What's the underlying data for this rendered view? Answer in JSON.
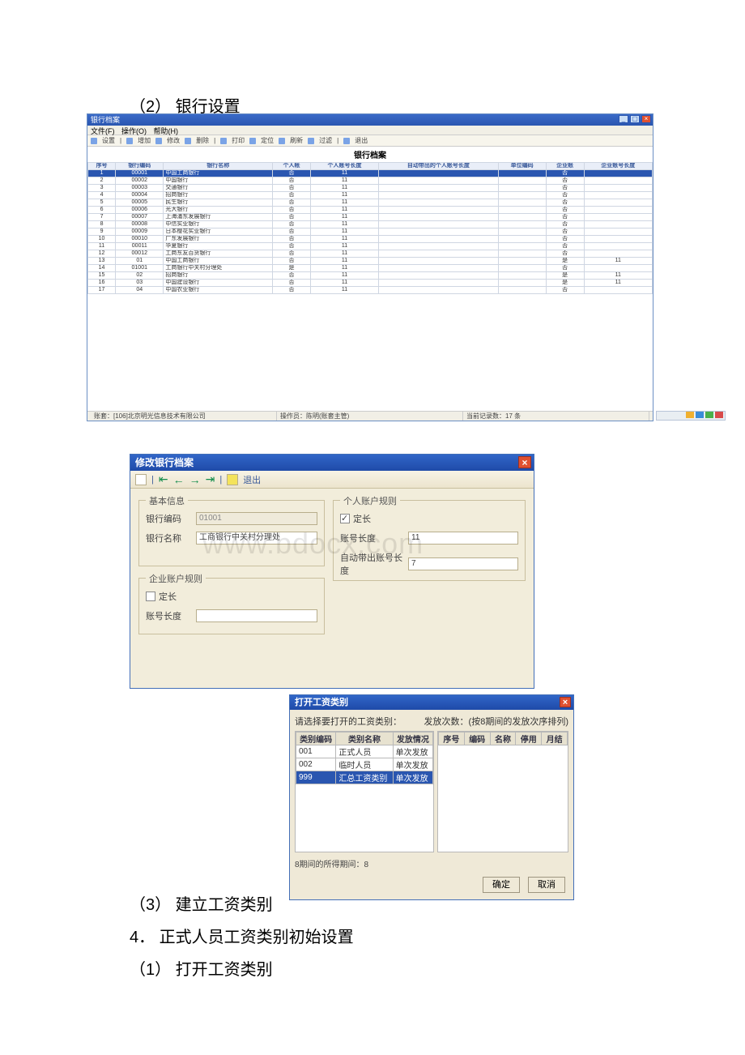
{
  "headings": {
    "h1": "（2） 银行设置",
    "h2": "（3） 建立工资类别",
    "h3": "4． 正式人员工资类别初始设置",
    "h4": "（1） 打开工资类别"
  },
  "watermark": "www.bdocx.com",
  "ss1": {
    "title": "银行档案",
    "menu": [
      "文件(F)",
      "操作(O)",
      "帮助(H)"
    ],
    "toolbar": [
      "设置",
      "增加",
      "修改",
      "删除",
      "打印",
      "定位",
      "刷新",
      "过滤",
      "退出"
    ],
    "body_title": "银行档案",
    "columns": [
      "序号",
      "银行编码",
      "银行名称",
      "个人帐",
      "个人账号长度",
      "自动带出的个人账号长度",
      "单位编码",
      "企业账",
      "企业账号长度"
    ],
    "rows": [
      {
        "seq": "1",
        "code": "00001",
        "name": "中国工商银行",
        "p": "否",
        "plen": "11",
        "auto": "",
        "u": "",
        "e": "否",
        "elen": ""
      },
      {
        "seq": "2",
        "code": "00002",
        "name": "中国银行",
        "p": "否",
        "plen": "11",
        "auto": "",
        "u": "",
        "e": "否",
        "elen": ""
      },
      {
        "seq": "3",
        "code": "00003",
        "name": "交通银行",
        "p": "否",
        "plen": "11",
        "auto": "",
        "u": "",
        "e": "否",
        "elen": ""
      },
      {
        "seq": "4",
        "code": "00004",
        "name": "招商银行",
        "p": "否",
        "plen": "11",
        "auto": "",
        "u": "",
        "e": "否",
        "elen": ""
      },
      {
        "seq": "5",
        "code": "00005",
        "name": "民生银行",
        "p": "否",
        "plen": "11",
        "auto": "",
        "u": "",
        "e": "否",
        "elen": ""
      },
      {
        "seq": "6",
        "code": "00006",
        "name": "光大银行",
        "p": "否",
        "plen": "11",
        "auto": "",
        "u": "",
        "e": "否",
        "elen": ""
      },
      {
        "seq": "7",
        "code": "00007",
        "name": "上海浦东发展银行",
        "p": "否",
        "plen": "11",
        "auto": "",
        "u": "",
        "e": "否",
        "elen": ""
      },
      {
        "seq": "8",
        "code": "00008",
        "name": "中信实业银行",
        "p": "否",
        "plen": "11",
        "auto": "",
        "u": "",
        "e": "否",
        "elen": ""
      },
      {
        "seq": "9",
        "code": "00009",
        "name": "日本樱花实业银行",
        "p": "否",
        "plen": "11",
        "auto": "",
        "u": "",
        "e": "否",
        "elen": ""
      },
      {
        "seq": "10",
        "code": "00010",
        "name": "广东发展银行",
        "p": "否",
        "plen": "11",
        "auto": "",
        "u": "",
        "e": "否",
        "elen": ""
      },
      {
        "seq": "11",
        "code": "00011",
        "name": "华夏银行",
        "p": "否",
        "plen": "11",
        "auto": "",
        "u": "",
        "e": "否",
        "elen": ""
      },
      {
        "seq": "12",
        "code": "00012",
        "name": "工商东友百货银行",
        "p": "否",
        "plen": "11",
        "auto": "",
        "u": "",
        "e": "否",
        "elen": ""
      },
      {
        "seq": "13",
        "code": "01",
        "name": "中国工商银行",
        "p": "否",
        "plen": "11",
        "auto": "",
        "u": "",
        "e": "是",
        "elen": "11"
      },
      {
        "seq": "14",
        "code": "01001",
        "name": "工商银行中关村分理处",
        "p": "是",
        "plen": "11",
        "auto": "",
        "u": "",
        "e": "否",
        "elen": ""
      },
      {
        "seq": "15",
        "code": "02",
        "name": "招商银行",
        "p": "否",
        "plen": "11",
        "auto": "",
        "u": "",
        "e": "是",
        "elen": "11"
      },
      {
        "seq": "16",
        "code": "03",
        "name": "中国建设银行",
        "p": "否",
        "plen": "11",
        "auto": "",
        "u": "",
        "e": "是",
        "elen": "11"
      },
      {
        "seq": "17",
        "code": "04",
        "name": "中国农业银行",
        "p": "否",
        "plen": "11",
        "auto": "",
        "u": "",
        "e": "否",
        "elen": ""
      }
    ],
    "status": {
      "left": "账套：[106]北京明光信息技术有限公司",
      "center": "操作员：陈明(账套主管)",
      "right": "当前记录数：17 条"
    }
  },
  "ss2": {
    "title": "修改银行档案",
    "exit_label": "退出",
    "groups": {
      "basic": "基本信息",
      "personal": "个人账户规则",
      "enterprise": "企业账户规则"
    },
    "labels": {
      "bank_code": "银行编码",
      "bank_name": "银行名称",
      "fixed_len": "定长",
      "acct_len": "账号长度",
      "auto_prefix": "自动带出账号长度"
    },
    "values": {
      "bank_code": "01001",
      "bank_name": "工商银行中关村分理处",
      "personal_fixed": true,
      "personal_len": "11",
      "auto_prefix_len": "7",
      "enterprise_fixed": false,
      "enterprise_len": ""
    }
  },
  "ss3": {
    "title": "打开工资类别",
    "prompt_left": "请选择要打开的工资类别：",
    "prompt_right": "发放次数：(按8期间的发放次序排列)",
    "left_cols": [
      "类别编码",
      "类别名称",
      "发放情况"
    ],
    "left_rows": [
      {
        "code": "001",
        "name": "正式人员",
        "pay": "单次发放"
      },
      {
        "code": "002",
        "name": "临时人员",
        "pay": "单次发放"
      },
      {
        "code": "999",
        "name": "汇总工资类别",
        "pay": "单次发放"
      }
    ],
    "right_cols": [
      "序号",
      "编码",
      "名称",
      "停用",
      "月结"
    ],
    "period_label": "8期间的所得期间：8",
    "buttons": {
      "ok": "确定",
      "cancel": "取消"
    }
  }
}
